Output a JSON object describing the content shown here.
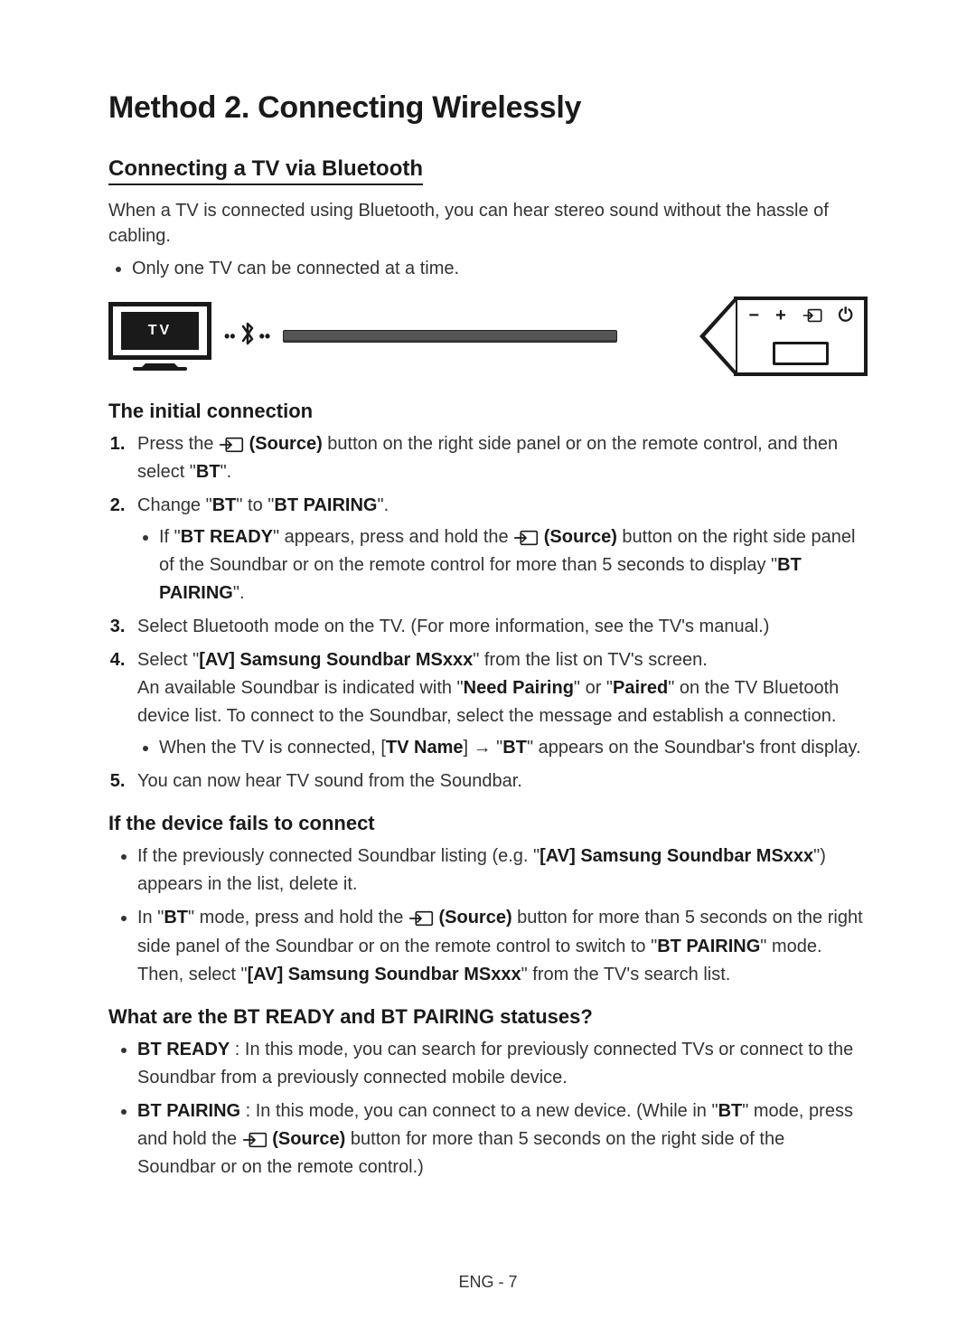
{
  "title": "Method 2. Connecting Wirelessly",
  "subtitle": "Connecting a TV via Bluetooth",
  "intro": "When a TV is connected using Bluetooth, you can hear stereo sound without the hassle of cabling.",
  "intro_bullet": "Only one TV can be connected at a time.",
  "diagram": {
    "tv_label": "TV",
    "panel_buttons": {
      "minus": "−",
      "plus": "+",
      "source": "source-icon",
      "power": "⏻"
    }
  },
  "sec_initial": "The initial connection",
  "steps": {
    "s1_a": "Press the ",
    "s1_b": " (Source)",
    "s1_c": " button on the right side panel or on the remote control, and then select \"",
    "s1_d": "BT",
    "s1_e": "\".",
    "s2_a": "Change \"",
    "s2_b": "BT",
    "s2_c": "\" to \"",
    "s2_d": "BT PAIRING",
    "s2_e": "\".",
    "s2_sub_a": "If \"",
    "s2_sub_b": "BT READY",
    "s2_sub_c": "\" appears, press and hold the ",
    "s2_sub_d": " (Source)",
    "s2_sub_e": " button on the right side panel of the Soundbar or on the remote control for more than 5 seconds to display \"",
    "s2_sub_f": "BT PAIRING",
    "s2_sub_g": "\".",
    "s3": "Select Bluetooth mode on the TV. (For more information, see the TV's manual.)",
    "s4_a": "Select \"",
    "s4_b": "[AV] Samsung Soundbar MSxxx",
    "s4_c": "\" from the list on TV's screen.",
    "s4_p2_a": "An available Soundbar is indicated with \"",
    "s4_p2_b": "Need Pairing",
    "s4_p2_c": "\" or \"",
    "s4_p2_d": "Paired",
    "s4_p2_e": "\" on the TV Bluetooth device list. To connect to the Soundbar, select the message and establish a connection.",
    "s4_sub_a": "When the TV is connected, [",
    "s4_sub_b": "TV Name",
    "s4_sub_c": "] → \"",
    "s4_sub_d": "BT",
    "s4_sub_e": "\" appears on the Soundbar's front display.",
    "s5": "You can now hear TV sound from the Soundbar."
  },
  "sec_fail": "If the device fails to connect",
  "fail": {
    "b1_a": "If the previously connected Soundbar listing (e.g. \"",
    "b1_b": "[AV] Samsung Soundbar MSxxx",
    "b1_c": "\") appears in the list, delete it.",
    "b2_a": "In \"",
    "b2_b": "BT",
    "b2_c": "\" mode, press and hold the ",
    "b2_d": " (Source)",
    "b2_e": " button for more than 5 seconds on the right side panel of the Soundbar or on the remote control to switch to \"",
    "b2_f": "BT PAIRING",
    "b2_g": "\" mode.",
    "b2_h": "Then, select \"",
    "b2_i": "[AV] Samsung Soundbar MSxxx",
    "b2_j": "\" from the TV's search list."
  },
  "sec_status": "What are the BT READY and BT PAIRING statuses?",
  "status": {
    "ready_a": "BT READY",
    "ready_b": " : In this mode, you can search for previously connected TVs or connect to the Soundbar from a previously connected mobile device.",
    "pair_a": "BT PAIRING",
    "pair_b": " : In this mode, you can connect to a new device. (While in \"",
    "pair_c": "BT",
    "pair_d": "\" mode, press and hold the ",
    "pair_e": " (Source)",
    "pair_f": " button for more than 5 seconds on the right side of the Soundbar or on the remote control.)"
  },
  "footer": "ENG - 7"
}
